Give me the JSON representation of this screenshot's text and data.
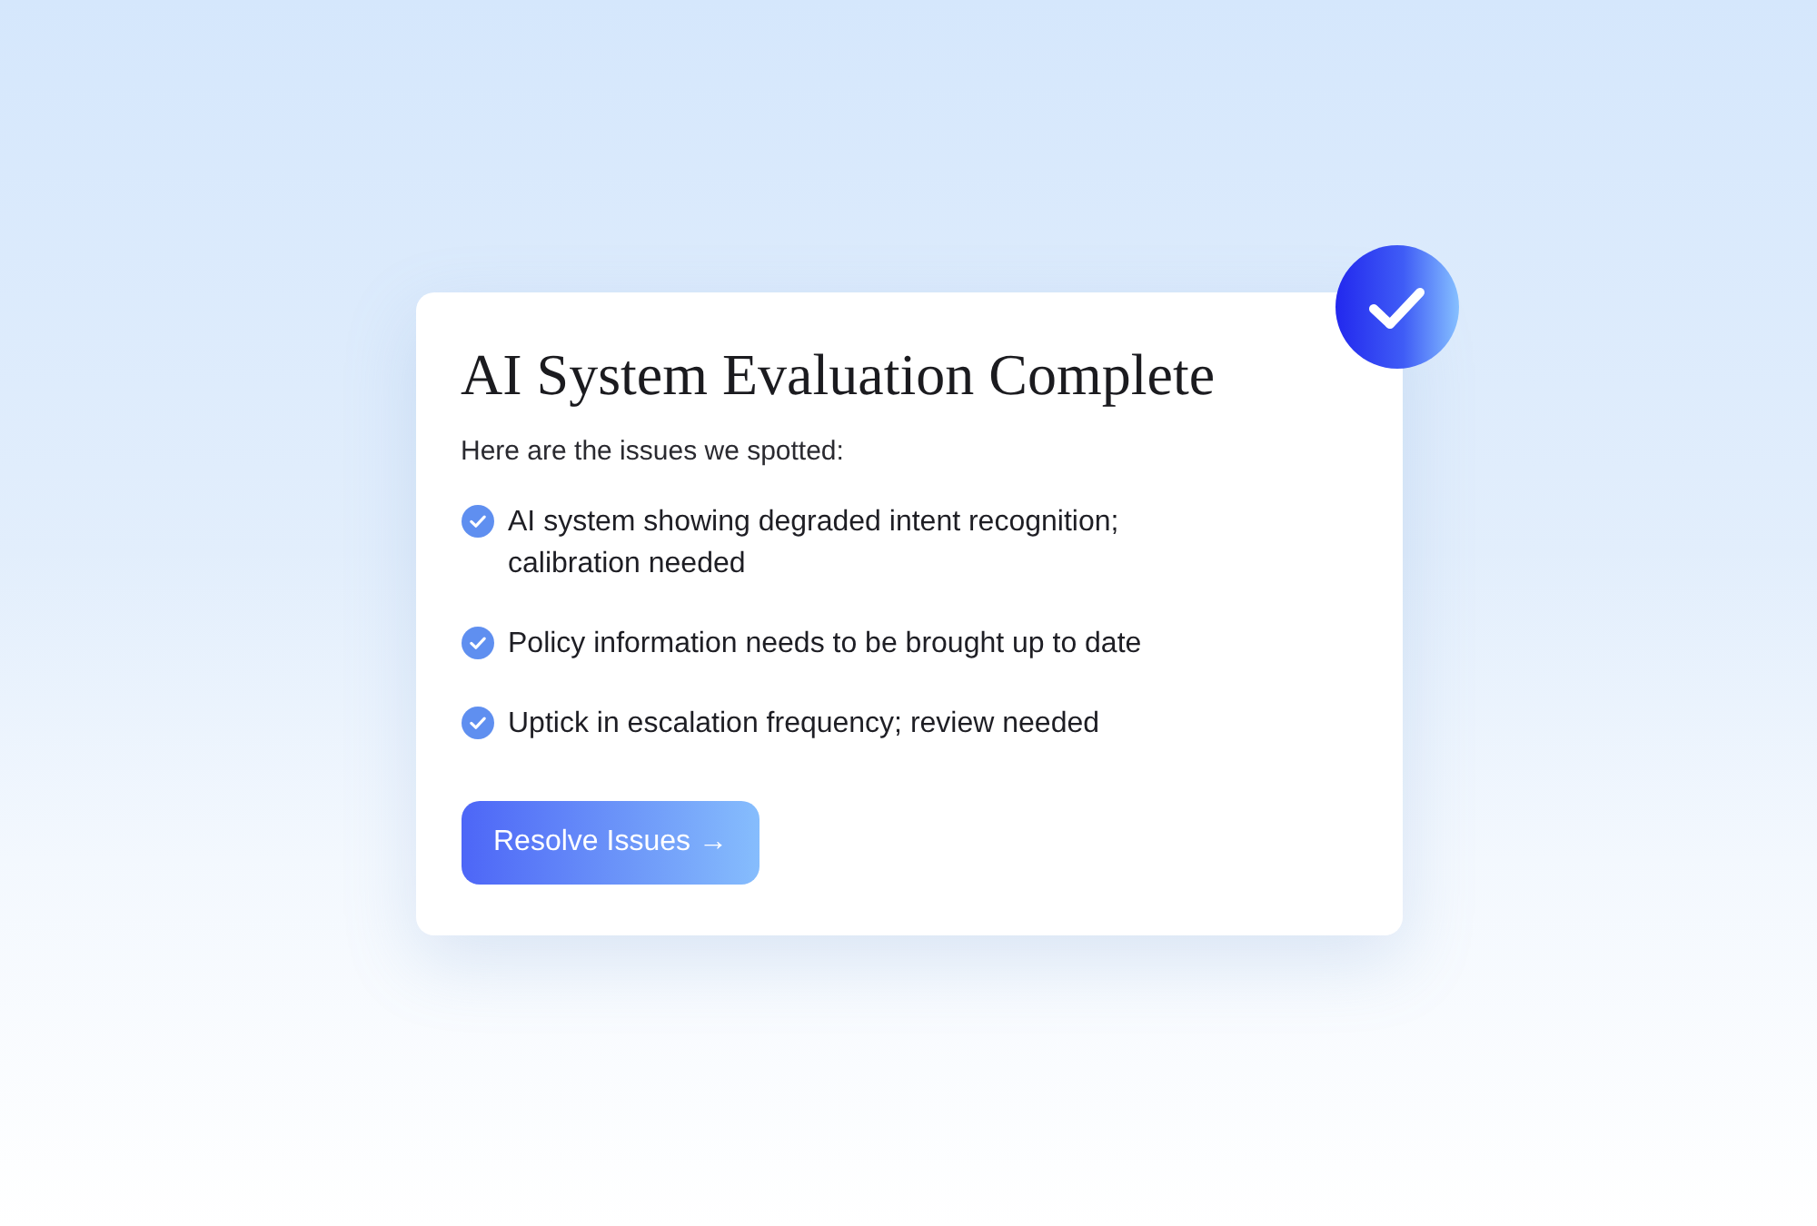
{
  "card": {
    "title": "AI System Evaluation Complete",
    "subtitle": "Here are the issues we spotted:",
    "issues": [
      {
        "text": "AI system showing degraded intent recognition; calibration needed"
      },
      {
        "text": "Policy information needs to be brought up to date"
      },
      {
        "text": "Uptick in escalation frequency; review needed"
      }
    ],
    "button": {
      "label": "Resolve Issues →"
    }
  }
}
